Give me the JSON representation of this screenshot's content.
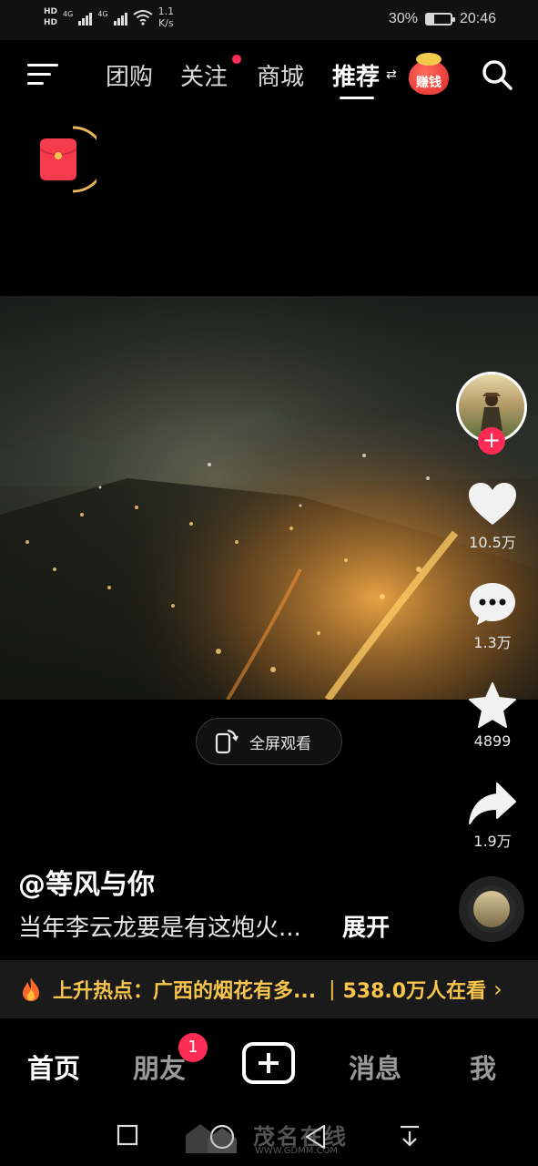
{
  "status_bar": {
    "network_speed": "1.1",
    "network_speed_unit": "K/s",
    "signal_1": "4G",
    "signal_2": "4G",
    "hd_1": "HD",
    "hd_2": "HD",
    "battery_percent": "30%",
    "battery_level": 0.3,
    "time": "20:46"
  },
  "top_nav": {
    "tabs": [
      {
        "label": "团购"
      },
      {
        "label": "关注"
      },
      {
        "label": "商城"
      },
      {
        "label": "推荐"
      }
    ],
    "active_tab": "推荐",
    "earn_label": "赚钱",
    "icons": [
      "menu-icon",
      "swap-icon",
      "search-icon"
    ]
  },
  "video": {
    "fullscreen_label": "全屏观看"
  },
  "right_rail": {
    "likes": "10.5万",
    "comments": "1.3万",
    "favorites": "4899",
    "shares": "1.9万"
  },
  "caption": {
    "author": "@等风与你",
    "description": "当年李云龙要是有这炮火...",
    "expand": "展开"
  },
  "hot_bar": {
    "text": "上升热点：广西的烟花有多...",
    "separator": "|",
    "viewers": "538.0万人在看",
    "chevron": "›"
  },
  "bottom_nav": {
    "items": [
      {
        "label": "首页"
      },
      {
        "label": "朋友"
      },
      {
        "label": "消息"
      },
      {
        "label": "我"
      }
    ],
    "friend_badge": "1"
  },
  "watermark": {
    "text": "茂名在线",
    "url": "WWW.GDMM.COM"
  },
  "colors": {
    "accent": "#fe2c55",
    "hot": "#f7c44c",
    "background": "#000000"
  }
}
